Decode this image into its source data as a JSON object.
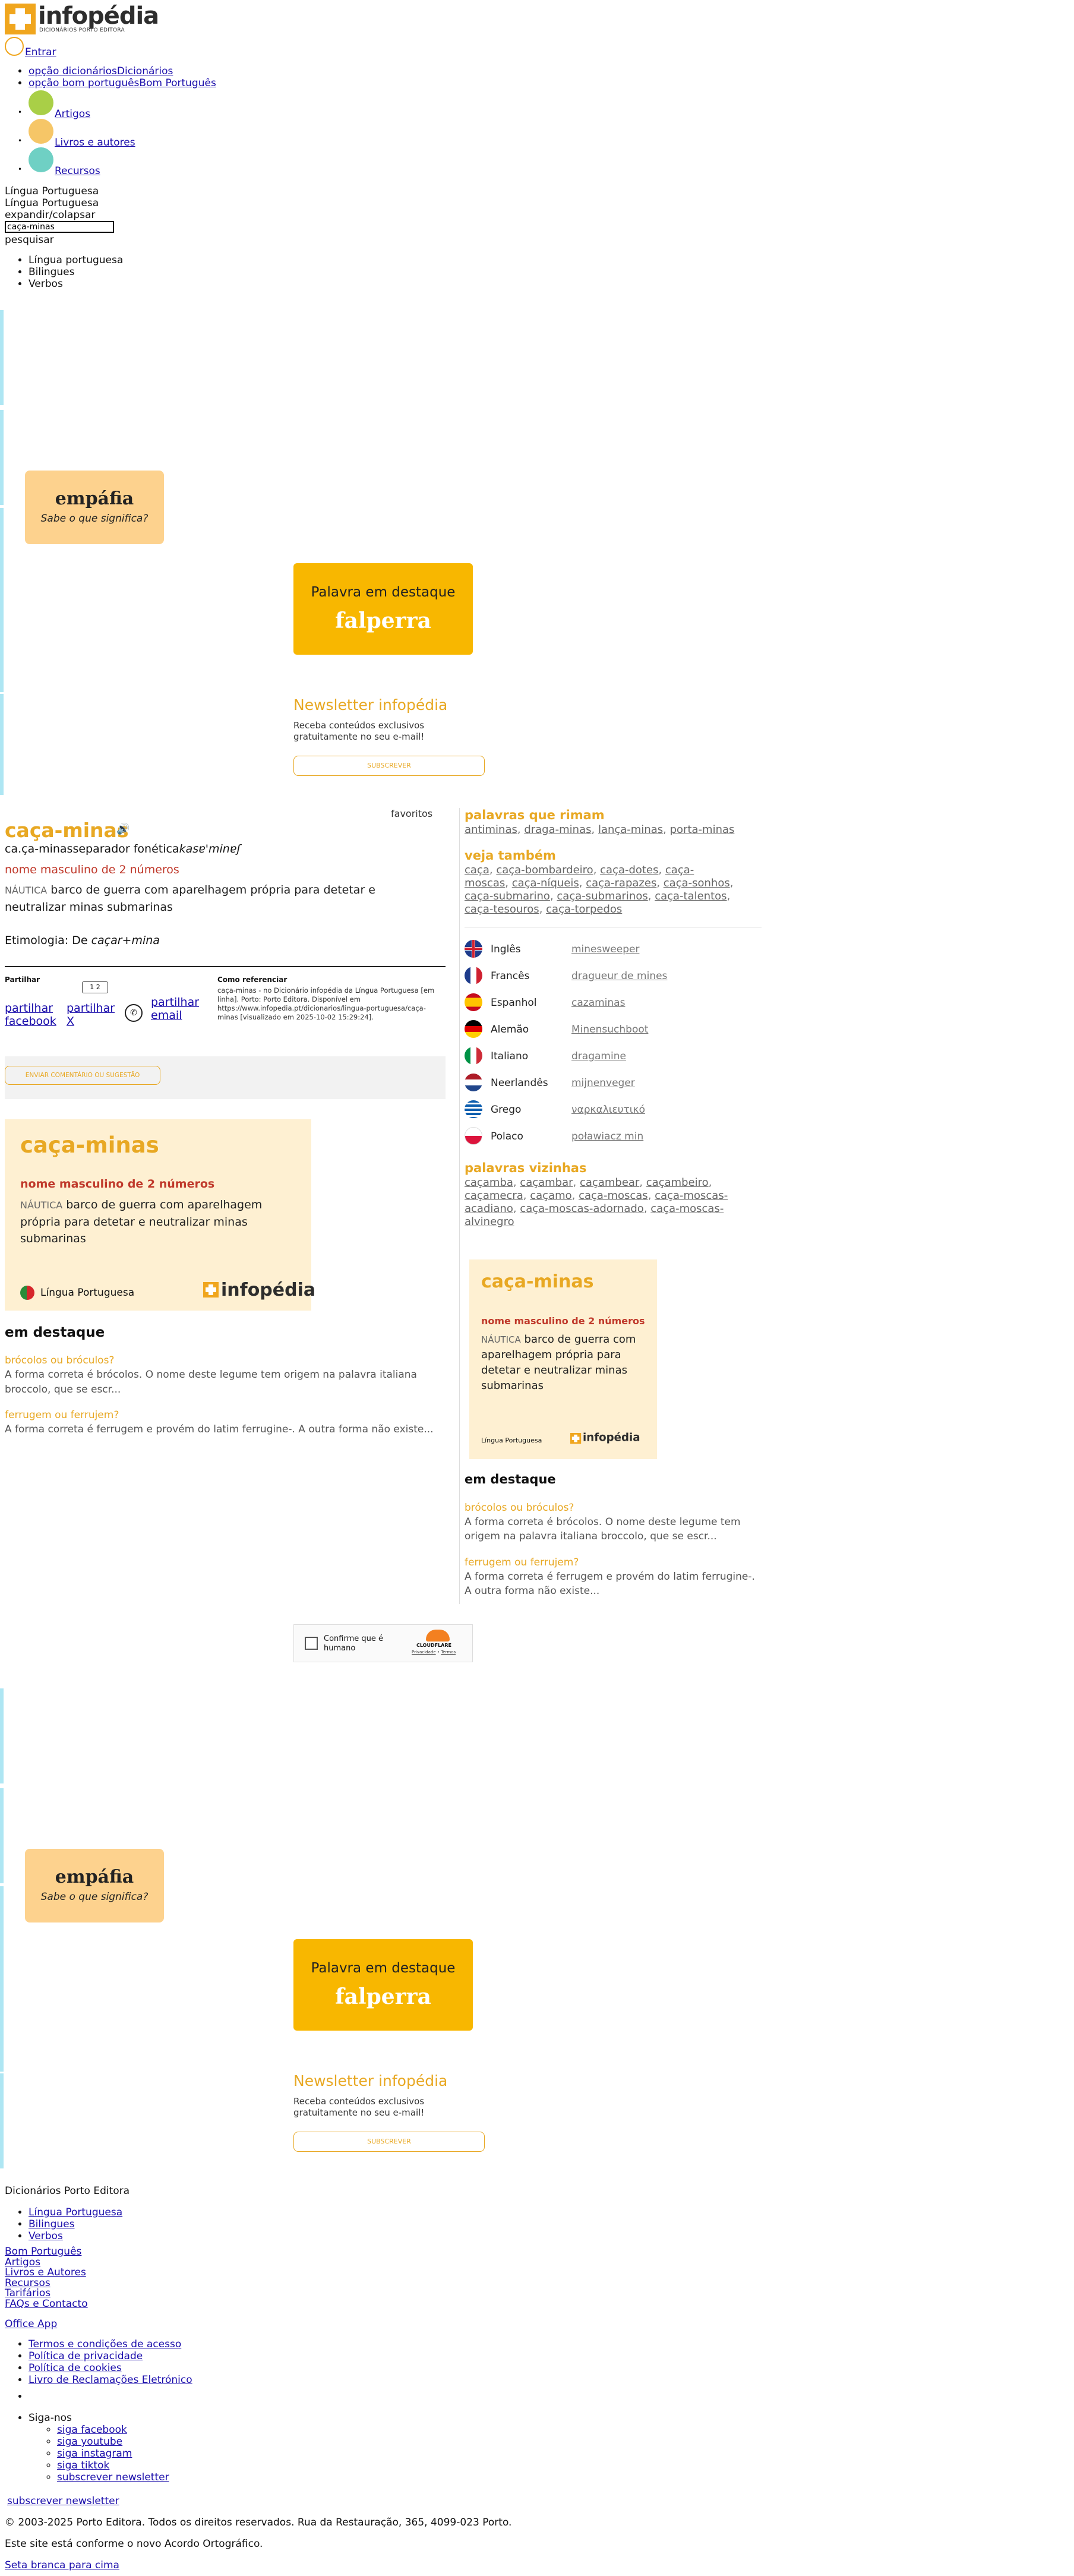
{
  "header": {
    "logo_text": "infopédia",
    "logo_sub": "DICIONÁRIOS PORTO EDITORA",
    "login": "Entrar",
    "nav": [
      {
        "alt": "opção dicionários",
        "label": "Dicionários"
      },
      {
        "alt": "opção bom português",
        "label": "Bom Português"
      },
      {
        "label": "Artigos"
      },
      {
        "label": "Livros e autores"
      },
      {
        "label": "Recursos"
      }
    ],
    "colors": {
      "artigos": "#a9cf47",
      "livros": "#f6c667",
      "recursos": "#6fd0c4",
      "login": "#f0a61e"
    }
  },
  "search": {
    "dictionary_label": "Língua Portuguesa",
    "dictionary_label2": "Língua Portuguesa",
    "expand_alt": "expandir/colapsar",
    "value": "caça-minas",
    "search_alt": "pesquisar",
    "options": [
      "Língua portuguesa",
      "Bilingues",
      "Verbos"
    ]
  },
  "promo": {
    "empafia_word": "empáfia",
    "empafia_sub": "Sabe o que significa?",
    "palavra_title": "Palavra em destaque",
    "palavra_word": "falperra",
    "newsletter_title": "Newsletter infopédia",
    "newsletter_text": "Receba conteúdos exclusivos gratuitamente no seu e-mail!",
    "newsletter_button": "SUBSCREVER"
  },
  "entry": {
    "favorites_alt": "favoritos",
    "word": "caça-minas",
    "syllables": "ca.ça-minas",
    "phon_alt": "separador fonética",
    "phonetic": "kasɐ'minɐʃ",
    "grammar": "nome masculino de 2 números",
    "domain": "NÁUTICA",
    "definition": "barco de guerra com aparelhagem própria para detetar e neutralizar minas submarinas",
    "etym_label": "Etimologia: De",
    "etym_value": "caçar+mina",
    "share_label": "Partilhar",
    "share_facebook": "partilhar facebook",
    "share_x": "partilhar X",
    "share_email": "partilhar email",
    "ref_title": "Como referenciar",
    "ref_text": "caça-minas - no Dicionário infopédia da Língua Portuguesa [em linha]. Porto: Porto Editora. Disponível em https://www.infopedia.pt/dicionarios/lingua-portuguesa/caça-minas [visualizado em 2025-10-02 15:29:24].",
    "comment_button": "ENVIAR COMENTÁRIO OU SUGESTÃO"
  },
  "card": {
    "word": "caça-minas",
    "grammar": "nome masculino de 2 números",
    "domain": "NÁUTICA",
    "definition": "barco de guerra com aparelhagem própria para detetar e neutralizar minas submarinas",
    "footer_label": "Língua Portuguesa",
    "logo_text": "infopédia",
    "logo_sub": "DICIONÁRIOS PORTO EDITORA"
  },
  "destaque": {
    "title": "em destaque",
    "items": [
      {
        "title": "brócolos ou bróculos?",
        "text": "A forma correta é brócolos. O nome deste legume tem origem na palavra italiana broccolo, que se escr..."
      },
      {
        "title": "ferrugem ou ferrujem?",
        "text": "A forma correta é ferrugem e provém do latim ferrugine-. A outra forma não existe..."
      }
    ]
  },
  "sidebar": {
    "rimam_title": "palavras que rimam",
    "rimam": [
      "antiminas",
      "draga-minas",
      "lança-minas",
      "porta-minas"
    ],
    "veja_title": "veja também",
    "veja": [
      "caça",
      "caça-bombardeiro",
      "caça-dotes",
      "caça-moscas",
      "caça-níqueis",
      "caça-rapazes",
      "caça-sonhos",
      "caça-submarino",
      "caça-submarinos",
      "caça-talentos",
      "caça-tesouros",
      "caça-torpedos"
    ],
    "translations": [
      {
        "lang": "Inglês",
        "word": "minesweeper"
      },
      {
        "lang": "Francês",
        "word": "dragueur de mines"
      },
      {
        "lang": "Espanhol",
        "word": "cazaminas"
      },
      {
        "lang": "Alemão",
        "word": "Minensuchboot"
      },
      {
        "lang": "Italiano",
        "word": "dragamine"
      },
      {
        "lang": "Neerlandês",
        "word": "mijnenveger"
      },
      {
        "lang": "Grego",
        "word": "ναρκαλιευτικό"
      },
      {
        "lang": "Polaco",
        "word": "poławiacz min"
      }
    ],
    "vizinhas_title": "palavras vizinhas",
    "vizinhas": [
      "caçamba",
      "caçambar",
      "caçambear",
      "caçambeiro",
      "caçamecra",
      "caçamo",
      "caça-moscas",
      "caça-moscas-acadiano",
      "caça-moscas-adornado",
      "caça-moscas-alvinegro"
    ]
  },
  "captcha": {
    "label": "Confirme que é humano",
    "brand": "CLOUDFLARE",
    "privacy": "Privacidade",
    "terms": "Termos"
  },
  "footer": {
    "title": "Dicionários Porto Editora",
    "dicts": [
      "Língua Portuguesa",
      "Bilingues",
      "Verbos"
    ],
    "links": [
      "Bom Português",
      "Artigos",
      "Livros e Autores",
      "Recursos",
      "Tarifários",
      "FAQs e Contacto"
    ],
    "office": "Office App",
    "legal": [
      "Termos e condições de acesso",
      "Política de privacidade",
      "Política de cookies",
      "Livro de Reclamações Eletrónico"
    ],
    "follow": "Siga-nos",
    "social": [
      "siga facebook",
      "siga youtube",
      "siga instagram",
      "siga tiktok"
    ],
    "subscribe_inner": "subscrever newsletter",
    "subscribe": "subscrever newsletter",
    "copyright": "© 2003-2025 Porto Editora. Todos os direitos reservados. Rua da Restauração, 365, 4099-023 Porto.",
    "acordo": "Este site está conforme o novo Acordo Ortográfico.",
    "top": "Seta branca para cima"
  }
}
